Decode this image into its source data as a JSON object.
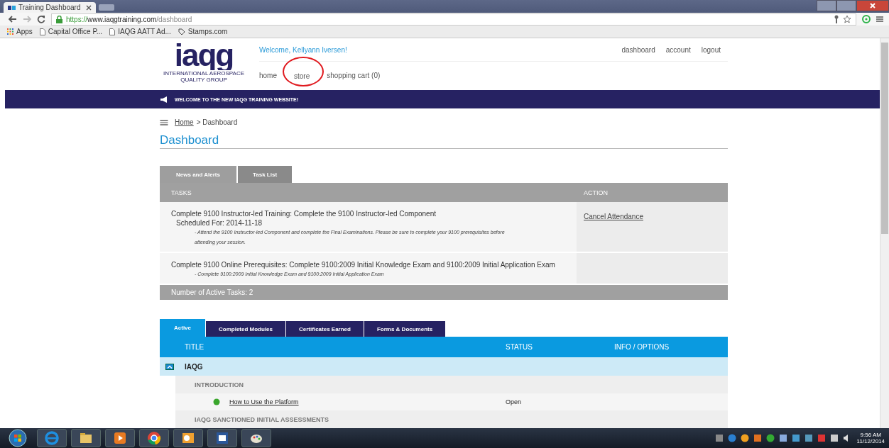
{
  "browser": {
    "tab_title": "Training Dashboard",
    "url_scheme": "https://",
    "url_host": "www.iaqgtraining.com",
    "url_path": "/dashboard",
    "bookmarks": [
      {
        "kind": "apps",
        "label": "Apps"
      },
      {
        "kind": "page",
        "label": "Capital Office P..."
      },
      {
        "kind": "page",
        "label": "IAQG AATT Ad..."
      },
      {
        "kind": "tag",
        "label": "Stamps.com"
      }
    ]
  },
  "header": {
    "logo_text": "iaqg",
    "logo_caption": "INTERNATIONAL AEROSPACE QUALITY GROUP",
    "welcome": "Welcome, Kellyann Iversen!",
    "user_links": [
      "dashboard",
      "account",
      "logout"
    ],
    "nav": [
      {
        "label": "home",
        "circled": false
      },
      {
        "label": "store",
        "circled": true
      },
      {
        "label": "shopping cart (0)",
        "circled": false
      }
    ]
  },
  "banner": "WELCOME TO THE NEW IAQG TRAINING WEBSITE!",
  "breadcrumb": {
    "link": "Home",
    "current": "> Dashboard"
  },
  "page_title": "Dashboard",
  "task_tabs": [
    {
      "label": "News and Alerts",
      "selected": false
    },
    {
      "label": "Task List",
      "selected": true
    }
  ],
  "tasks": {
    "columns": [
      "TASKS",
      "ACTION"
    ],
    "rows": [
      {
        "title": "Complete 9100 Instructor-led Training: Complete the 9100 Instructor-led Component",
        "scheduled": "Scheduled For: 2014-11-18",
        "note": "- Attend the 9100 Instructor-led Component and complete the Final Examinations. Please be sure to complete your 9100 prerequisites before attending your session.",
        "action": "Cancel Attendance"
      },
      {
        "title": "Complete 9100 Online Prerequisites: Complete 9100:2009 Initial Knowledge Exam and 9100:2009 Initial Application Exam",
        "note": "- Complete 9100:2009 Initial Knowledge Exam and 9100:2009 Initial Application Exam"
      }
    ],
    "footer": "Number of Active Tasks:  2"
  },
  "module_tabs": [
    {
      "label": "Active",
      "selected": true
    },
    {
      "label": "Completed Modules",
      "selected": false
    },
    {
      "label": "Certificates Earned",
      "selected": false
    },
    {
      "label": "Forms & Documents",
      "selected": false
    }
  ],
  "modules": {
    "columns": [
      "TITLE",
      "STATUS",
      "INFO / OPTIONS"
    ],
    "groups": [
      {
        "name": "IAQG",
        "expanded": true,
        "sections": [
          {
            "name": "INTRODUCTION",
            "items": [
              {
                "title": "How to Use the Platform",
                "status": "Open"
              }
            ]
          },
          {
            "name": "IAQG SANCTIONED INITIAL ASSESSMENTS"
          }
        ]
      }
    ]
  },
  "taskbar": {
    "time": "9:56 AM",
    "date": "11/12/2014"
  }
}
